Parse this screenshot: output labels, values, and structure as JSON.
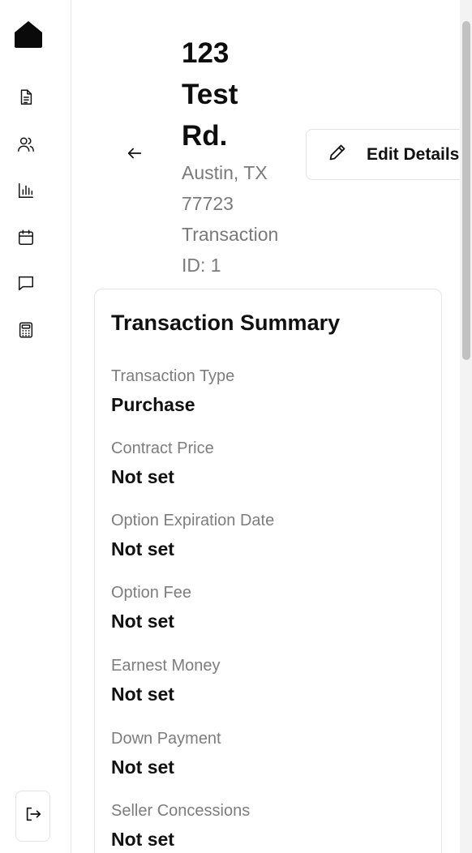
{
  "sidebar": {
    "logo": "house-logo",
    "items": [
      {
        "name": "document-icon"
      },
      {
        "name": "users-icon"
      },
      {
        "name": "bar-chart-icon"
      },
      {
        "name": "calendar-icon"
      },
      {
        "name": "message-icon"
      },
      {
        "name": "calculator-icon"
      }
    ],
    "logout_icon": "logout-icon"
  },
  "header": {
    "title": "123 Test Rd.",
    "subtitle": "Austin, TX 77723 Transaction ID: 1",
    "edit_label": "Edit Details"
  },
  "summary": {
    "title": "Transaction Summary",
    "fields": [
      {
        "label": "Transaction Type",
        "value": "Purchase"
      },
      {
        "label": "Contract Price",
        "value": "Not set"
      },
      {
        "label": "Option Expiration Date",
        "value": "Not set"
      },
      {
        "label": "Option Fee",
        "value": "Not set"
      },
      {
        "label": "Earnest Money",
        "value": "Not set"
      },
      {
        "label": "Down Payment",
        "value": "Not set"
      },
      {
        "label": "Seller Concessions",
        "value": "Not set"
      }
    ]
  },
  "colors": {
    "accent": "#111111",
    "muted": "#7a7a7a",
    "border": "#e5e5e5"
  }
}
